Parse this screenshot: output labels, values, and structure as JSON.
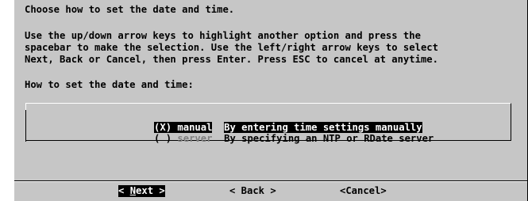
{
  "dialog": {
    "heading": "Choose how to set the date and time.",
    "instructions": [
      "Use the up/down arrow keys to highlight another option and press the",
      "spacebar to make the selection. Use the left/right arrow keys to select",
      "Next, Back or Cancel, then press Enter. Press ESC to cancel at anytime."
    ],
    "prompt": "How to set the date and time:",
    "options": [
      {
        "marker": "(X)",
        "tag": "manual",
        "description": "By entering time settings manually",
        "selected": true
      },
      {
        "marker": "( )",
        "tag": "server",
        "description": "By specifying an NTP or RDate server",
        "selected": false
      }
    ],
    "buttons": {
      "next": {
        "left": "< ",
        "hotkey": "N",
        "rest": "ext >"
      },
      "back": "< Back >",
      "cancel": "<Cancel>"
    }
  },
  "colors": {
    "dialog_bg": "#c6c6c6",
    "highlight_bg": "#000000",
    "highlight_fg": "#ffffff",
    "dim_text": "#808080"
  }
}
